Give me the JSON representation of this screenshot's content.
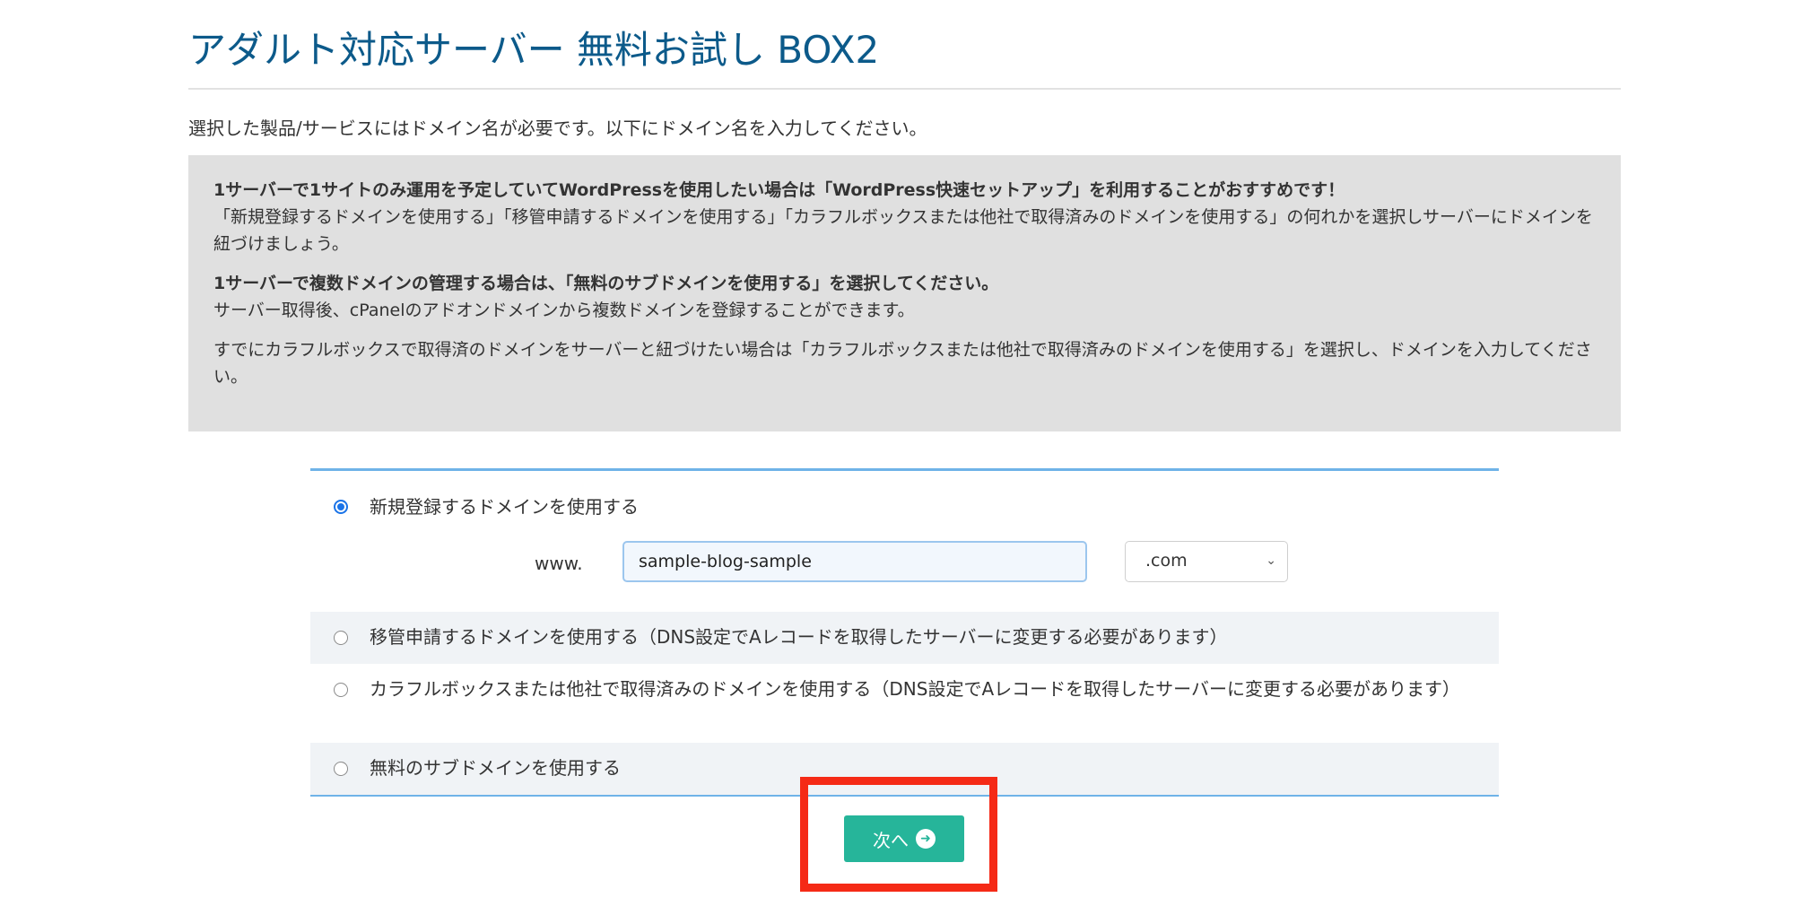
{
  "page": {
    "title": "アダルト対応サーバー 無料お試し BOX2",
    "intro": "選択した製品/サービスにはドメイン名が必要です。以下にドメイン名を入力してください。"
  },
  "info": {
    "p1_bold": "1サーバーで1サイトのみ運用を予定していてWordPressを使用したい場合は「WordPress快速セットアップ」を利用することがおすすめです！",
    "p1_text": "「新規登録するドメインを使用する」「移管申請するドメインを使用する」「カラフルボックスまたは他社で取得済みのドメインを使用する」の何れかを選択しサーバーにドメインを紐づけましょう。",
    "p2_bold": "1サーバーで複数ドメインの管理する場合は、「無料のサブドメインを使用する」を選択してください。",
    "p2_text": "サーバー取得後、cPanelのアドオンドメインから複数ドメインを登録することができます。",
    "p3_text": "すでにカラフルボックスで取得済のドメインをサーバーと紐づけたい場合は「カラフルボックスまたは他社で取得済みのドメインを使用する」を選択し、ドメインを入力してください。"
  },
  "domain_options": {
    "register": {
      "label": "新規登録するドメインを使用する",
      "selected": true,
      "prefix": "www.",
      "input_value": "sample-blog-sample",
      "tld_selected": ".com"
    },
    "transfer": {
      "label": "移管申請するドメインを使用する（DNS設定でAレコードを取得したサーバーに変更する必要があります）",
      "selected": false
    },
    "owned": {
      "label": "カラフルボックスまたは他社で取得済みのドメインを使用する（DNS設定でAレコードを取得したサーバーに変更する必要があります）",
      "selected": false
    },
    "subdomain": {
      "label": "無料のサブドメインを使用する",
      "selected": false
    }
  },
  "next_button": {
    "label": "次へ",
    "icon": "arrow-circle-right-icon"
  },
  "colors": {
    "title": "#0c5a8a",
    "info_bg": "#e0e0e0",
    "panel_border": "#6fb3e8",
    "button": "#26b59a",
    "highlight": "#f52a16"
  }
}
